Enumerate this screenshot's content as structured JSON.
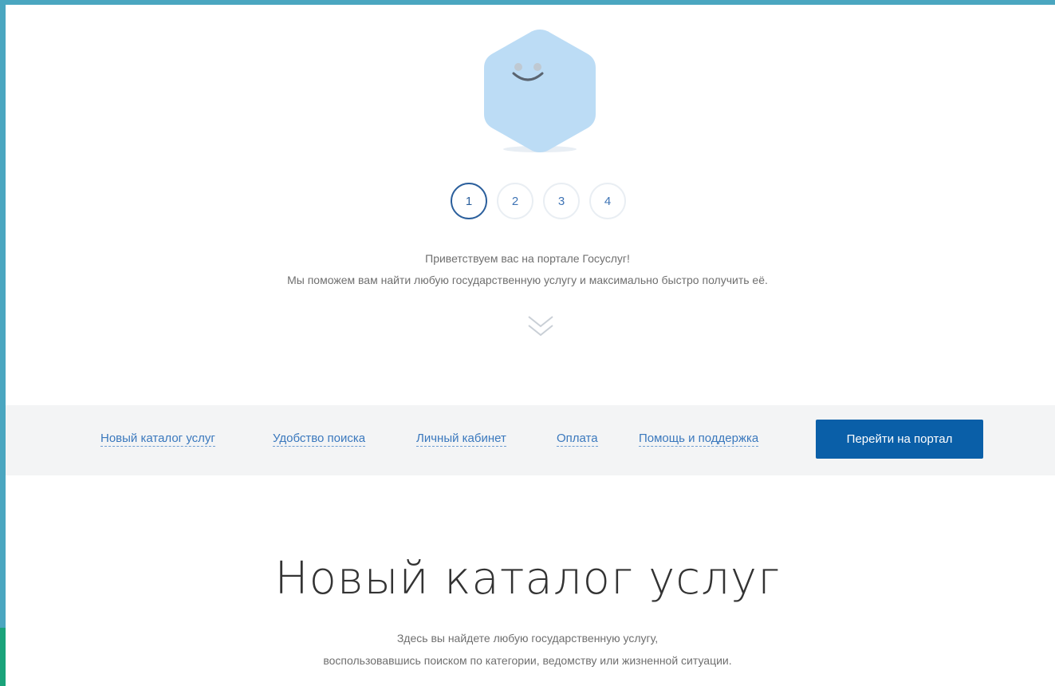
{
  "steps": {
    "items": [
      "1",
      "2",
      "3",
      "4"
    ],
    "active_index": 0
  },
  "intro": {
    "line1": "Приветствуем вас на портале Госуслуг!",
    "line2": "Мы поможем вам найти любую государственную услугу и максимально быстро получить её."
  },
  "scroll_icon": "double-chevron-down-icon",
  "nav": {
    "links": [
      "Новый каталог услуг",
      "Удобство поиска",
      "Личный кабинет",
      "Оплата",
      "Помощь и поддержка"
    ],
    "portal_button": "Перейти на портал"
  },
  "catalog": {
    "title": "Новый каталог услуг",
    "desc_line1": "Здесь вы найдете любую государственную услугу,",
    "desc_line2": "воспользовавшись поиском по категории, ведомству или жизненной ситуации."
  },
  "colors": {
    "frame": "#4aa6c0",
    "accent_blue": "#0a5fa8",
    "link_blue": "#3a78bd",
    "mascot_blue": "#bcdcf5",
    "nav_bg": "#f3f4f5"
  }
}
